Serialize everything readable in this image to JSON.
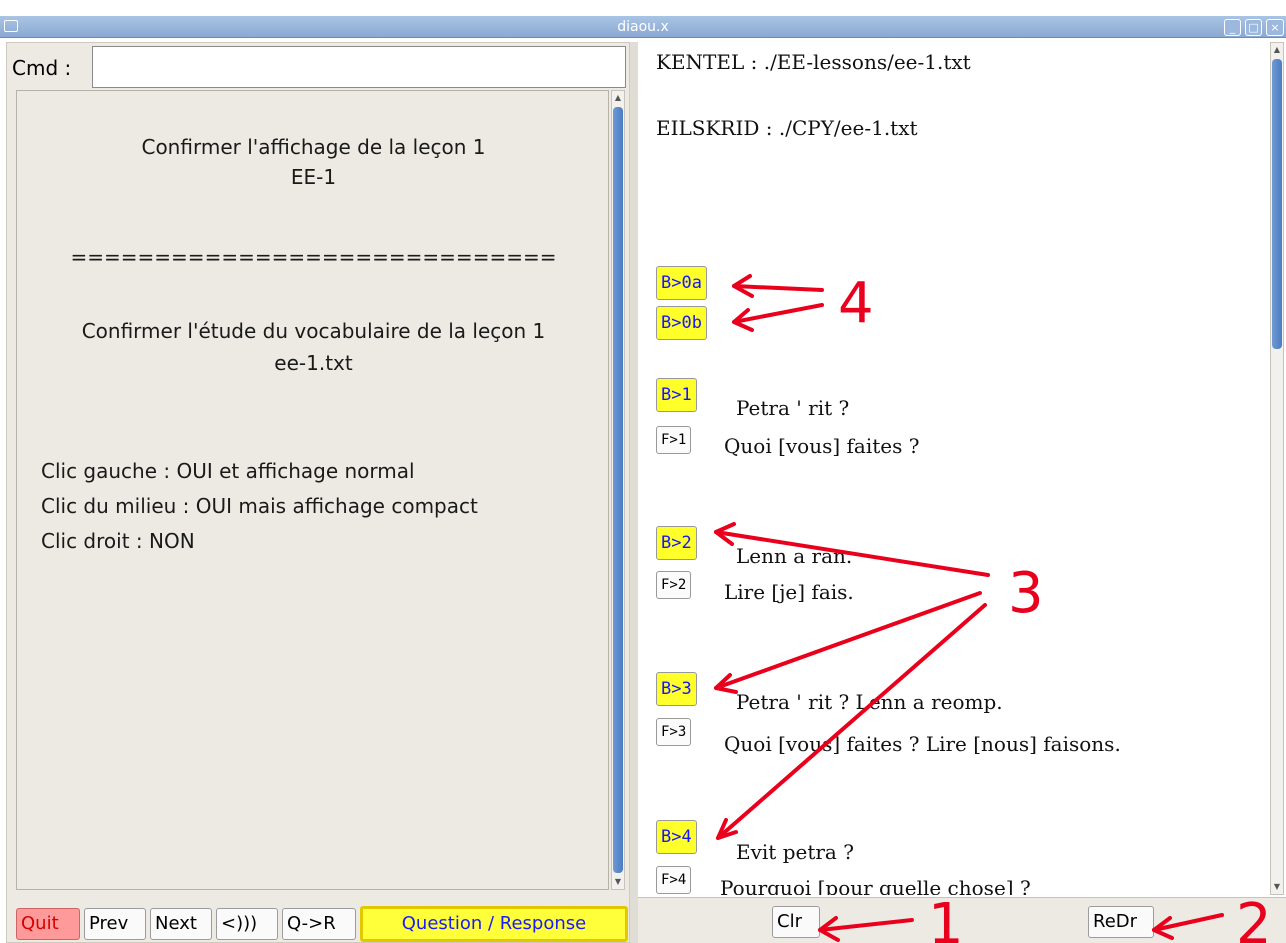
{
  "window": {
    "title": "diaou.x"
  },
  "cmd": {
    "label": "Cmd :",
    "value": ""
  },
  "message": {
    "line1": "Confirmer l'affichage de la leçon 1",
    "line2": "EE-1",
    "separator": "=============================",
    "line3": "Confirmer l'étude du vocabulaire de la leçon 1",
    "line4": "ee-1.txt",
    "option_left": "Clic gauche : OUI et affichage normal",
    "option_middle": "Clic du milieu : OUI mais affichage compact",
    "option_right": "Clic droit : NON"
  },
  "bottom_left": {
    "quit": "Quit",
    "prev": "Prev",
    "next": "Next",
    "sound": "<)))",
    "qr": "Q->R",
    "question_response": "Question / Response"
  },
  "right": {
    "kentel": "KENTEL : ./EE-lessons/ee-1.txt",
    "eilskrid": "EILSKRID : ./CPY/ee-1.txt",
    "b0a": "B>0a",
    "b0b": "B>0b",
    "entries": [
      {
        "b": "B>1",
        "f": "F>1",
        "breton": "Petra ' rit ?",
        "french": "Quoi [vous] faites ?"
      },
      {
        "b": "B>2",
        "f": "F>2",
        "breton": "Lenn a ran.",
        "french": "Lire [je] fais."
      },
      {
        "b": "B>3",
        "f": "F>3",
        "breton": "Petra ' rit ? Lenn a reomp.",
        "french": "Quoi [vous] faites ? Lire [nous] faisons."
      },
      {
        "b": "B>4",
        "f": "F>4",
        "breton": "Evit petra  ?",
        "french": "Pourquoi [pour quelle chose] ?"
      }
    ],
    "clr": "Clr",
    "redr": "ReDr"
  },
  "annotations": {
    "n1": "1",
    "n2": "2",
    "n3": "3",
    "n4": "4",
    "color": "#e8001c"
  },
  "colors": {
    "yellow": "#ffff2a",
    "blue_text": "#1515ff",
    "quit_red": "#ff9a9a",
    "titlebar": "#9db8de"
  }
}
